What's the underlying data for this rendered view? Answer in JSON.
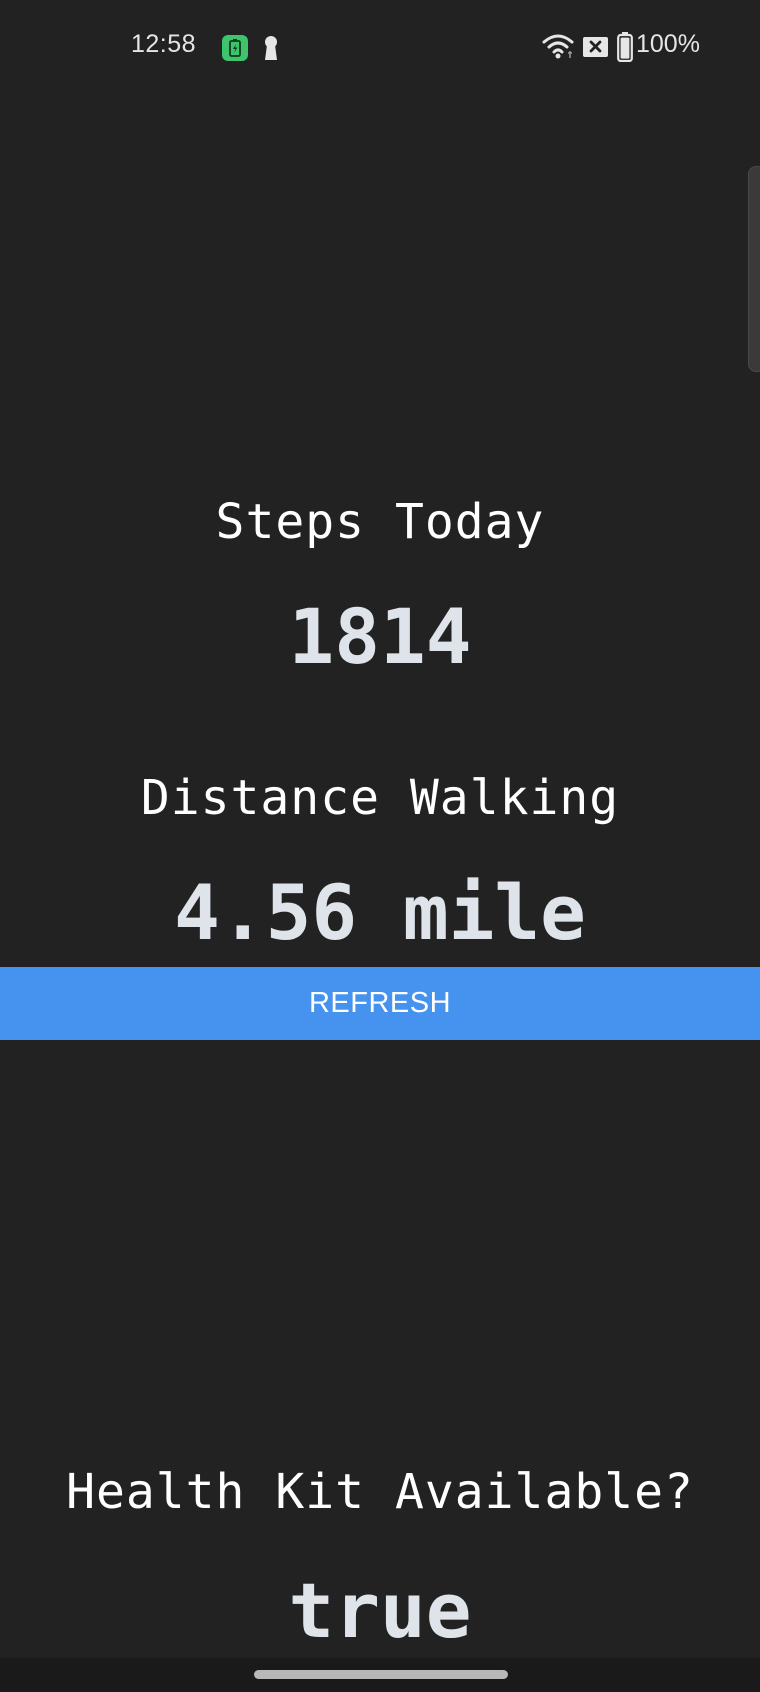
{
  "status_bar": {
    "time": "12:58",
    "battery_percent": "100%",
    "icons": [
      "battery-saver-app-icon",
      "keyhole-icon",
      "wifi-icon",
      "no-sim-icon",
      "battery-icon"
    ]
  },
  "steps": {
    "label": "Steps Today",
    "value": "1814"
  },
  "distance": {
    "label": "Distance Walking",
    "value": "4.56 mile"
  },
  "refresh_button": {
    "label": "REFRESH"
  },
  "health_kit": {
    "label": "Health Kit Available?",
    "value": "true"
  },
  "colors": {
    "background": "#222222",
    "button": "#4693ef",
    "label_text": "#ffffff",
    "value_text": "#dfe3ea"
  }
}
